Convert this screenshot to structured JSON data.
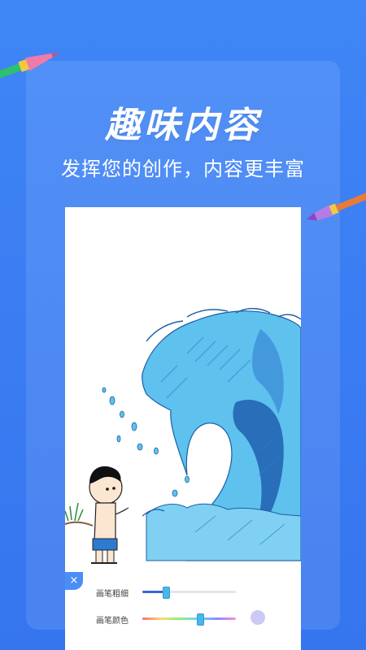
{
  "header": {
    "title": "趣味内容",
    "subtitle": "发挥您的创作，内容更丰富"
  },
  "tools": {
    "close_glyph": "×",
    "brush_size": {
      "label": "画笔粗细",
      "value": 0.25
    },
    "brush_color": {
      "label": "画笔颜色",
      "value": 0.62,
      "selected_color": "#cdc9f5"
    }
  },
  "colors": {
    "background": "#3f86f6",
    "accent": "#4a8ef5"
  },
  "icons": {
    "close": "close-icon",
    "decor_left": "brush-pen-icon",
    "decor_right": "brush-pen-icon"
  }
}
